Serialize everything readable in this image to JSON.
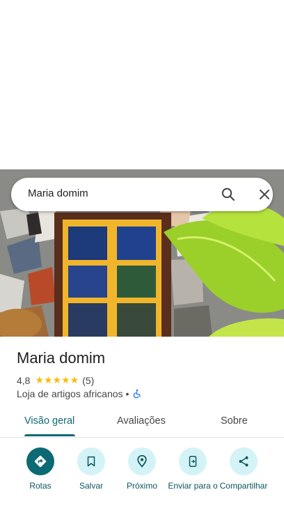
{
  "search": {
    "query": "Maria domim"
  },
  "place": {
    "name": "Maria domim",
    "rating": "4,8",
    "stars": "★★★★★",
    "review_count": "(5)",
    "category": "Loja de artigos africanos",
    "separator": "•"
  },
  "tabs": [
    {
      "label": "Visão geral",
      "active": true
    },
    {
      "label": "Avaliações",
      "active": false
    },
    {
      "label": "Sobre",
      "active": false
    }
  ],
  "actions": [
    {
      "label": "Rotas",
      "icon": "directions-icon"
    },
    {
      "label": "Salvar",
      "icon": "bookmark-icon"
    },
    {
      "label": "Próximo",
      "icon": "nearby-icon"
    },
    {
      "label": "Enviar para o",
      "icon": "send-to-phone-icon"
    },
    {
      "label": "Compartilhar",
      "icon": "share-icon"
    }
  ],
  "colors": {
    "accent": "#0b6a73",
    "action_bg": "#d3f3f7",
    "star": "#fbbc04",
    "wheelchair": "#1a73e8"
  }
}
